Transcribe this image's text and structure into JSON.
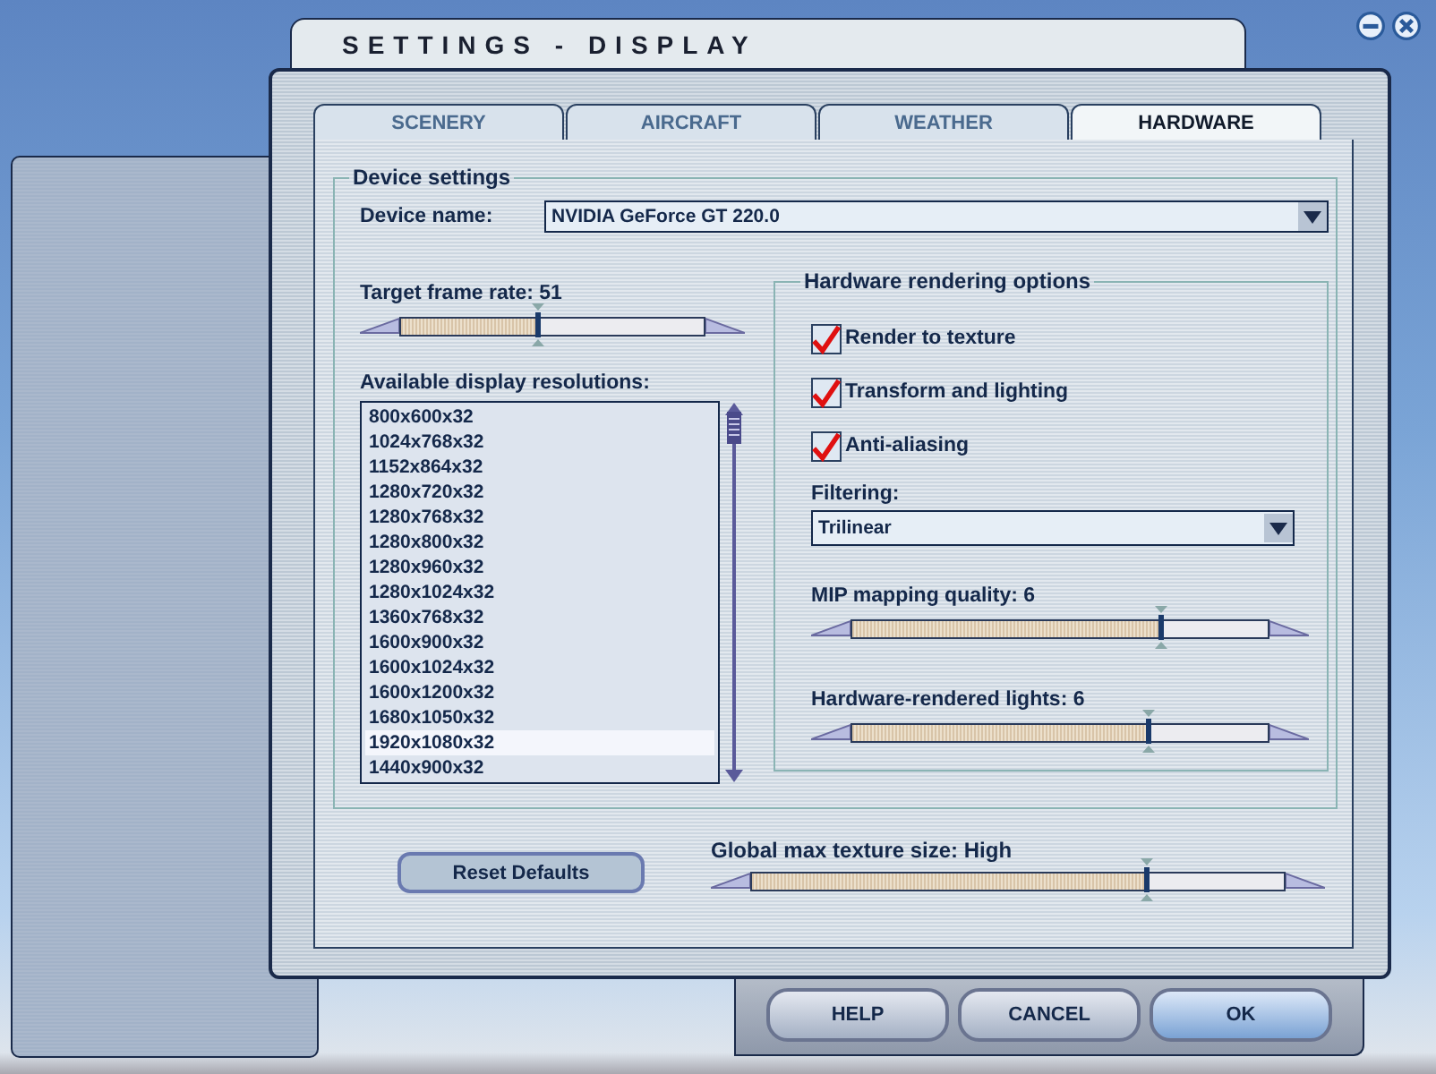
{
  "window": {
    "title": "SETTINGS - DISPLAY"
  },
  "tabs": [
    {
      "label": "SCENERY",
      "selected": false
    },
    {
      "label": "AIRCRAFT",
      "selected": false
    },
    {
      "label": "WEATHER",
      "selected": false
    },
    {
      "label": "HARDWARE",
      "selected": true
    }
  ],
  "device_settings": {
    "title": "Device settings",
    "device_name": {
      "label": "Device name:",
      "value": "NVIDIA GeForce GT 220.0"
    },
    "frame_rate": {
      "label": "Target frame rate: 51",
      "level": 0.45
    },
    "resolutions": {
      "label": "Available display resolutions:",
      "items": [
        {
          "text": "800x600x32",
          "selected": false
        },
        {
          "text": "1024x768x32",
          "selected": false
        },
        {
          "text": "1152x864x32",
          "selected": false
        },
        {
          "text": "1280x720x32",
          "selected": false
        },
        {
          "text": "1280x768x32",
          "selected": false
        },
        {
          "text": "1280x800x32",
          "selected": false
        },
        {
          "text": "1280x960x32",
          "selected": false
        },
        {
          "text": "1280x1024x32",
          "selected": false
        },
        {
          "text": "1360x768x32",
          "selected": false
        },
        {
          "text": "1600x900x32",
          "selected": false
        },
        {
          "text": "1600x1024x32",
          "selected": false
        },
        {
          "text": "1600x1200x32",
          "selected": false
        },
        {
          "text": "1680x1050x32",
          "selected": false
        },
        {
          "text": "1920x1080x32",
          "selected": true
        },
        {
          "text": "1440x900x32",
          "selected": false
        }
      ]
    },
    "hardware_rendering": {
      "title": "Hardware rendering options",
      "options": [
        {
          "label": "Render to texture",
          "checked": true
        },
        {
          "label": "Transform and lighting",
          "checked": true
        },
        {
          "label": "Anti-aliasing",
          "checked": true
        }
      ],
      "filtering": {
        "label": "Filtering:",
        "value": "Trilinear"
      },
      "mip_mapping": {
        "label": "MIP mapping quality: 6",
        "level": 0.74
      },
      "lights": {
        "label": "Hardware-rendered lights: 6",
        "level": 0.71
      }
    }
  },
  "reset_button": "Reset Defaults",
  "texture_size": {
    "label": "Global max texture size: High",
    "level": 0.74
  },
  "buttons": [
    {
      "label": "HELP",
      "kind": "normal"
    },
    {
      "label": "CANCEL",
      "kind": "normal"
    },
    {
      "label": "OK",
      "kind": "default"
    }
  ]
}
